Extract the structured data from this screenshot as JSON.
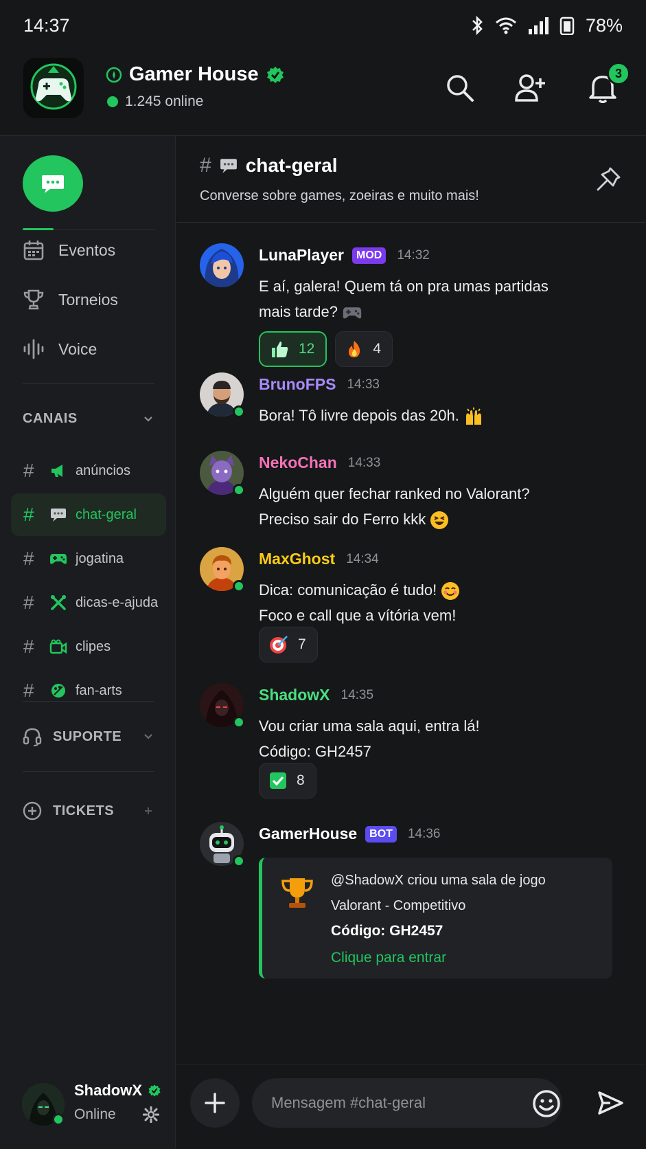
{
  "status_bar": {
    "time": "14:37",
    "battery": "78%"
  },
  "server": {
    "name": "Gamer House",
    "online": "1.245 online",
    "notification_count": "3"
  },
  "sidebar": {
    "nav": [
      {
        "label": "Eventos",
        "icon": "calendar-icon"
      },
      {
        "label": "Torneios",
        "icon": "trophy-icon"
      },
      {
        "label": "Voice",
        "icon": "voice-icon"
      }
    ],
    "channels_section": "CANAIS",
    "channels": [
      {
        "name": "anúncios",
        "icon": "megaphone-icon"
      },
      {
        "name": "chat-geral",
        "icon": "speech-bubble-icon",
        "active": true
      },
      {
        "name": "jogatina",
        "icon": "gamepad-icon"
      },
      {
        "name": "dicas-e-ajuda",
        "icon": "tools-icon"
      },
      {
        "name": "clipes",
        "icon": "video-camera-icon"
      },
      {
        "name": "fan-arts",
        "icon": "palette-icon"
      }
    ],
    "support_section": "SUPORTE",
    "tickets_section": "TICKETS"
  },
  "current_user": {
    "name": "ShadowX",
    "status": "Online"
  },
  "channel_header": {
    "hash": "#",
    "name": "chat-geral",
    "topic": "Converse sobre games, zoeiras e muito mais!"
  },
  "messages": [
    {
      "author": "LunaPlayer",
      "tag": "MOD",
      "time": "14:32",
      "lines": [
        "E aí, galera! Quem tá on pra umas partidas",
        "mais tarde?"
      ],
      "reactions": [
        {
          "emoji": "thumbs-up",
          "count": "12"
        },
        {
          "emoji": "fire",
          "count": "4"
        }
      ]
    },
    {
      "author": "BrunoFPS",
      "time": "14:33",
      "lines": [
        "Bora! Tô livre depois das 20h."
      ]
    },
    {
      "author": "NekoChan",
      "time": "14:33",
      "lines": [
        "Alguém quer fechar ranked no Valorant?",
        "Preciso sair do Ferro kkk"
      ]
    },
    {
      "author": "MaxGhost",
      "time": "14:34",
      "lines": [
        "Dica: comunicação é tudo!",
        "Foco e call que a vítória vem!"
      ],
      "reactions": [
        {
          "emoji": "target",
          "count": "7"
        }
      ]
    },
    {
      "author": "ShadowX",
      "time": "14:35",
      "lines": [
        "Vou criar uma sala aqui, entra lá!",
        "Código: GH2457"
      ],
      "reactions": [
        {
          "emoji": "check",
          "count": "8"
        }
      ]
    },
    {
      "author": "GamerHouse",
      "tag": "BOT",
      "time": "14:36",
      "embed": {
        "line1": "@ShadowX criou uma sala de jogo",
        "line2": "Valorant - Competitivo",
        "line3": "Código: GH2457",
        "link": "Clique para entrar"
      }
    }
  ],
  "composer": {
    "placeholder": "Mensagem #chat-geral"
  },
  "colors": {
    "accent": "#22c55e",
    "background": "#161719",
    "sidebar": "#1b1c1f",
    "mod_tag": "#7c3aed",
    "bot_tag": "#5b4cf0",
    "brunofps": "#a78bfa",
    "nekochan": "#f472b6",
    "maxghost": "#facc15",
    "shadowx": "#4ade80"
  }
}
